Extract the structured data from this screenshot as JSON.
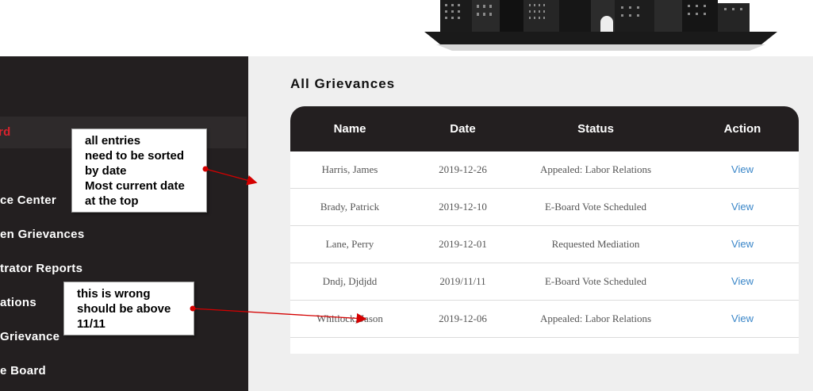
{
  "sidebar": {
    "items": [
      {
        "label": "rd",
        "active": true
      },
      {
        "label": "ce Center",
        "active": false
      },
      {
        "label": "en Grievances",
        "active": false
      },
      {
        "label": "trator Reports",
        "active": false
      },
      {
        "label": "ations",
        "active": false
      },
      {
        "label": " Grievance",
        "active": false
      },
      {
        "label": "e Board",
        "active": false
      }
    ]
  },
  "main": {
    "title": "All Grievances",
    "table": {
      "headers": [
        "Name",
        "Date",
        "Status",
        "Action"
      ],
      "rows": [
        {
          "name": "Harris, James",
          "date": "2019-12-26",
          "status": "Appealed: Labor Relations",
          "action": "View"
        },
        {
          "name": "Brady, Patrick",
          "date": "2019-12-10",
          "status": "E-Board Vote Scheduled",
          "action": "View"
        },
        {
          "name": "Lane, Perry",
          "date": "2019-12-01",
          "status": "Requested Mediation",
          "action": "View"
        },
        {
          "name": "Dndj, Djdjdd",
          "date": "2019/11/11",
          "status": "E-Board Vote Scheduled",
          "action": "View"
        },
        {
          "name": "Whitlock, Jason",
          "date": "2019-12-06",
          "status": "Appealed: Labor Relations",
          "action": "View"
        }
      ]
    }
  },
  "annotations": {
    "note1": "all entries\nneed to be sorted\nby date\nMost current date\nat the top",
    "note2": "this is wrong\nshould be above\n11/11",
    "arrow_color": "#d40000"
  },
  "colors": {
    "sidebar_bg": "#231f20",
    "active_item": "#d9232d",
    "link": "#3a86c8",
    "main_bg": "#efefef"
  }
}
